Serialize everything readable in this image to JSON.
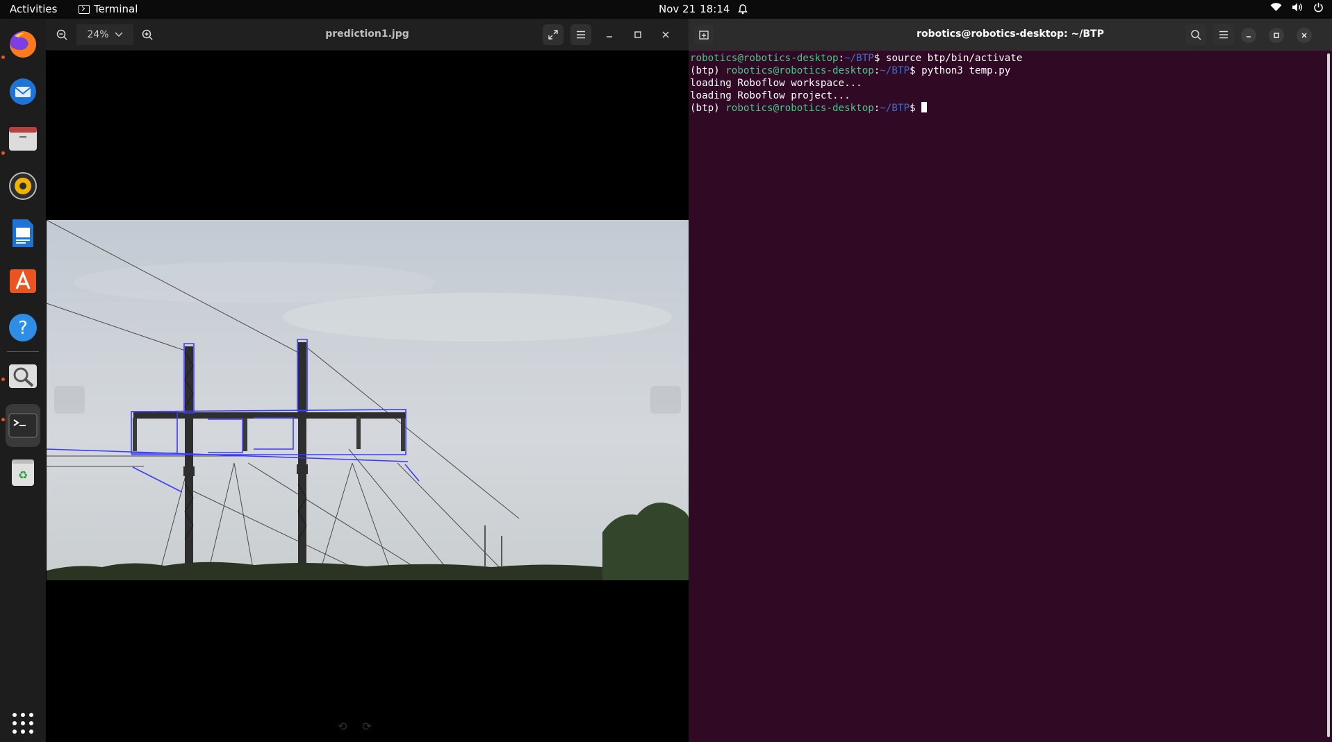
{
  "topbar": {
    "activities": "Activities",
    "app_name": "Terminal",
    "date": "Nov 21",
    "time": "18:14"
  },
  "dock": {
    "items": [
      "firefox-icon",
      "thunderbird-icon",
      "files-icon",
      "rhythmbox-icon",
      "writer-icon",
      "app-center-icon",
      "help-icon",
      "image-viewer-icon",
      "terminal-icon",
      "trash-icon",
      "show-apps-icon"
    ]
  },
  "viewer": {
    "zoom": "24%",
    "title": "prediction1.jpg"
  },
  "terminal": {
    "title": "robotics@robotics-desktop: ~/BTP",
    "lines": [
      {
        "env": "",
        "user": "robotics@robotics-desktop",
        "path": "~/BTP",
        "cmd": "source btp/bin/activate"
      },
      {
        "env": "(btp) ",
        "user": "robotics@robotics-desktop",
        "path": "~/BTP",
        "cmd": "python3 temp.py"
      },
      {
        "text": "loading Roboflow workspace..."
      },
      {
        "text": "loading Roboflow project..."
      },
      {
        "env": "(btp) ",
        "user": "robotics@robotics-desktop",
        "path": "~/BTP",
        "cmd": ""
      }
    ]
  },
  "colors": {
    "terminal_bg": "#300a24",
    "prompt_user": "#4bc48a",
    "prompt_path": "#3f70c8",
    "accent": "#e95420",
    "detection": "#3b3bff"
  }
}
